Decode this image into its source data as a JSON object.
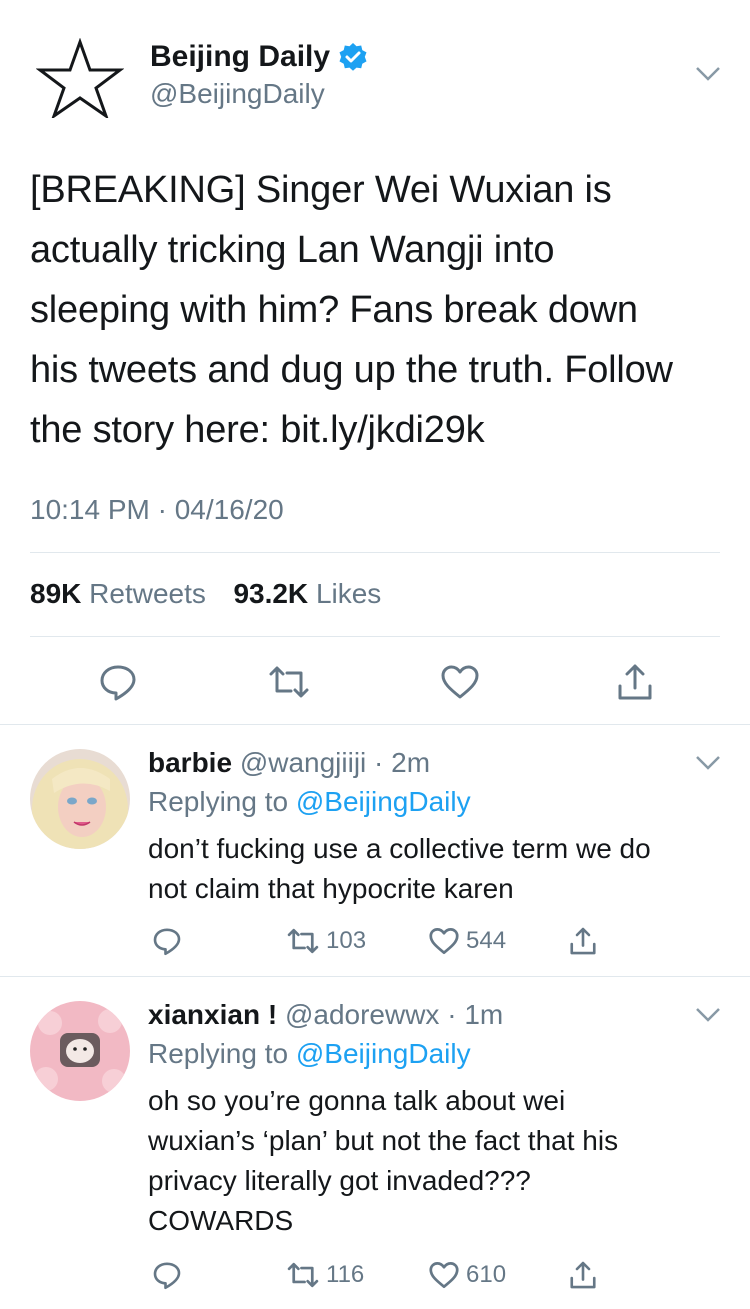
{
  "main_tweet": {
    "display_name": "Beijing Daily",
    "handle": "@BeijingDaily",
    "verified": true,
    "avatar_icon": "star-outline-icon",
    "text_lines": [
      "[BREAKING] Singer Wei Wuxian is",
      "actually tricking Lan Wangji into",
      "sleeping with him? Fans break down",
      "his tweets and dug up the truth. Follow",
      "the story here: bit.ly/jkdi29k"
    ],
    "timestamp": "10:14 PM · 04/16/20",
    "retweets_count": "89K",
    "retweets_label": "Retweets",
    "likes_count": "93.2K",
    "likes_label": "Likes",
    "actions": [
      "reply-icon",
      "retweet-icon",
      "like-icon",
      "share-icon"
    ]
  },
  "replies": [
    {
      "name": "barbie",
      "meta": "@wangjiiji · 2m",
      "replying_prefix": "Replying to",
      "replying_to": "@BeijingDaily",
      "text_lines": [
        "don’t fucking use a collective term we do",
        "not claim that hypocrite karen"
      ],
      "retweets": "103",
      "likes": "544"
    },
    {
      "name": "xianxian !",
      "meta": "@adorewwx · 1m",
      "replying_prefix": "Replying to",
      "replying_to": "@BeijingDaily",
      "text_lines": [
        "oh so you’re gonna talk about wei",
        "wuxian’s ‘plan’ but not the fact that his",
        "privacy literally got invaded???",
        "COWARDS"
      ],
      "retweets": "116",
      "likes": "610"
    }
  ],
  "colors": {
    "text": "#14171a",
    "secondary": "#657786",
    "link": "#1da1f2",
    "divider": "#e1e8ed",
    "verified": "#1da1f2"
  }
}
